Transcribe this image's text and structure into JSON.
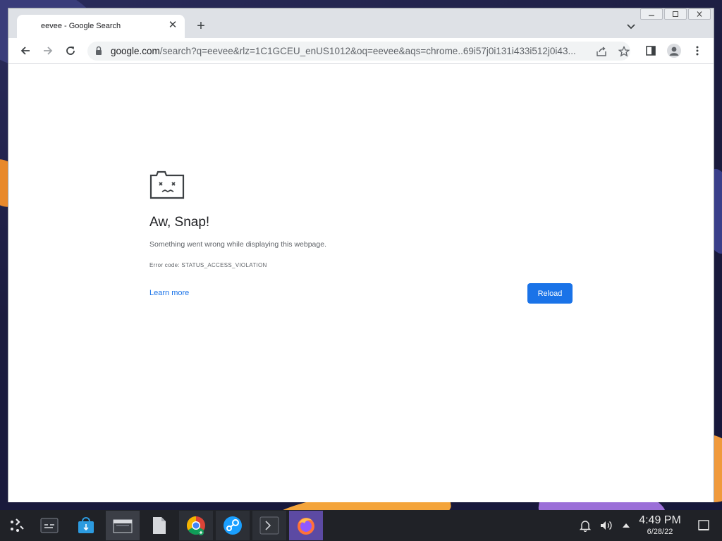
{
  "browser": {
    "tab_title": "eevee - Google Search",
    "url_host": "google.com",
    "url_rest": "/search?q=eevee&rlz=1C1GCEU_enUS1012&oq=eevee&aqs=chrome..69i57j0i131i433i512j0i43..."
  },
  "error_page": {
    "title": "Aw, Snap!",
    "message": "Something went wrong while displaying this webpage.",
    "code": "Error code: STATUS_ACCESS_VIOLATION",
    "learn_more": "Learn more",
    "reload": "Reload"
  },
  "taskbar": {
    "time": "4:49 PM",
    "date": "6/28/22",
    "apps": [
      "application-launcher-icon",
      "system-settings-icon",
      "discover-store-icon",
      "file-manager-icon",
      "text-file-icon",
      "chrome-icon",
      "steam-icon",
      "terminal-icon",
      "firefox-icon"
    ]
  },
  "colors": {
    "accent": "#1a73e8",
    "taskbar": "#202227",
    "tabstrip": "#dee1e6"
  }
}
